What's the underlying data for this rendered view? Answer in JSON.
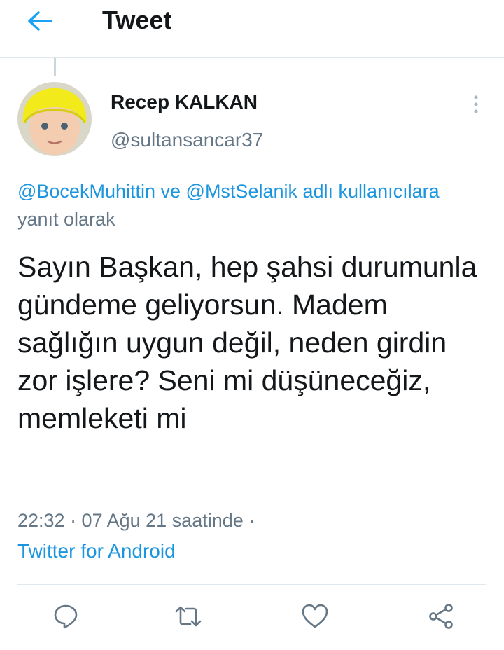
{
  "header": {
    "title": "Tweet",
    "back_icon": "arrow-left-icon"
  },
  "tweet": {
    "author_name": "Recep KALKAN",
    "author_handle": "@sultansancar37",
    "reply_context": {
      "mention1": "@BocekMuhittin",
      "connector": " ve ",
      "mention2": "@MstSelanik",
      "link_suffix": " adlı kullanıcılara",
      "tail": " yanıt olarak"
    },
    "text": "Sayın Başkan, hep şahsi durumunla gündeme geliyorsun. Madem sağlığın uygun değil, neden girdin zor işlere? Seni mi düşüneceğiz, memleketi mi",
    "meta": "22:32 · 07 Ağu 21 saatinde ·",
    "source": "Twitter for Android"
  },
  "actions": {
    "icons": [
      "reply-icon",
      "retweet-icon",
      "like-icon",
      "share-icon"
    ]
  },
  "colors": {
    "accent": "#1da1f2",
    "link": "#1b95e0",
    "secondary_text": "#657786",
    "primary_text": "#14171a",
    "divider": "#e1e8ed"
  }
}
